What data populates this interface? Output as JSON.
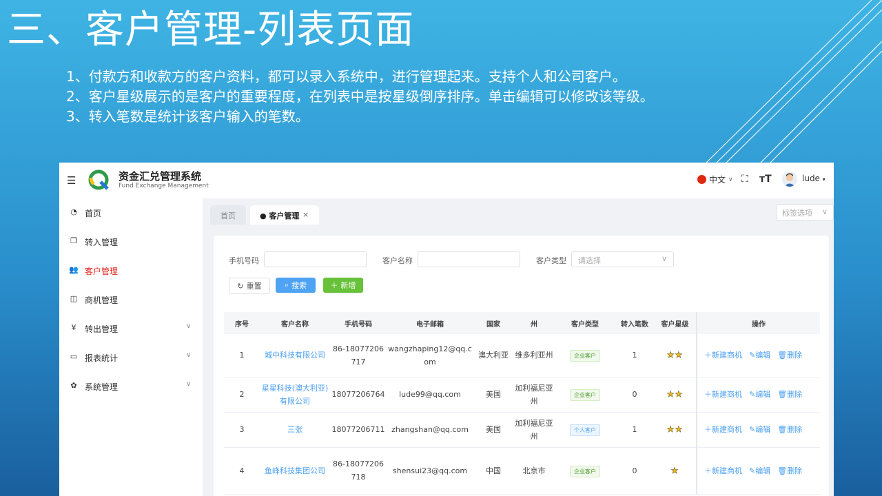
{
  "slide": {
    "title": "三、客户管理-列表页面",
    "notes": [
      "1、付款方和收款方的客户资料，都可以录入系统中，进行管理起来。支持个人和公司客户。",
      "2、客户星级展示的是客户的重要程度，在列表中是按星级倒序排序。单击编辑可以修改该等级。",
      "3、转入笔数是统计该客户输入的笔数。"
    ]
  },
  "header": {
    "system_name": "资金汇兑管理系统",
    "system_subtitle": "Fund Exchange Management",
    "language": "中文",
    "username": "lude"
  },
  "sidebar": {
    "items": [
      {
        "label": "首页",
        "icon": "dashboard-icon"
      },
      {
        "label": "转入管理",
        "icon": "copy-icon"
      },
      {
        "label": "客户管理",
        "icon": "users-icon",
        "active": true
      },
      {
        "label": "商机管理",
        "icon": "columns-icon"
      },
      {
        "label": "转出管理",
        "icon": "yen-icon",
        "expandable": true
      },
      {
        "label": "报表统计",
        "icon": "monitor-icon",
        "expandable": true
      },
      {
        "label": "系统管理",
        "icon": "gear-icon",
        "expandable": true
      }
    ]
  },
  "tabs": [
    {
      "label": "首页"
    },
    {
      "label": "客户管理",
      "active": true
    }
  ],
  "tag_options": "标签选项",
  "filters": {
    "phone_label": "手机号码",
    "name_label": "客户名称",
    "type_label": "客户类型",
    "type_placeholder": "请选择"
  },
  "buttons": {
    "reset": "重置",
    "search": "搜索",
    "add": "新增"
  },
  "table": {
    "columns": [
      "序号",
      "客户名称",
      "手机号码",
      "电子邮箱",
      "国家",
      "州",
      "客户类型",
      "转入笔数",
      "客户星级",
      "操作"
    ],
    "rows": [
      {
        "index": "1",
        "name": "城中科技有限公司",
        "phone": "86-18077206717",
        "email": "wangzhaping12@qq.com",
        "country": "澳大利亚",
        "state": "维多利亚州",
        "type": "企业客户",
        "type_kind": "corp",
        "count": "1",
        "stars": "★★"
      },
      {
        "index": "2",
        "name": "星星科技(澳大利亚)有限公司",
        "phone": "18077206764",
        "email": "lude99@qq.com",
        "country": "美国",
        "state": "加利福尼亚州",
        "type": "企业客户",
        "type_kind": "corp",
        "count": "0",
        "stars": "★★"
      },
      {
        "index": "3",
        "name": "三张",
        "phone": "18077206711",
        "email": "zhangshan@qq.com",
        "country": "美国",
        "state": "加利福尼亚州",
        "type": "个人客户",
        "type_kind": "pers",
        "count": "1",
        "stars": "★★"
      },
      {
        "index": "4",
        "name": "鱼峰科技集团公司",
        "phone": "86-18077206718",
        "email": "shensui23@qq.com",
        "country": "中国",
        "state": "北京市",
        "type": "企业客户",
        "type_kind": "corp",
        "count": "0",
        "stars": "★"
      }
    ],
    "actions": {
      "new_opportunity": "新建商机",
      "edit": "编辑",
      "delete": "删除"
    }
  },
  "colors": {
    "accent": "#4a9ff0",
    "active_menu": "#e6271f",
    "add_button": "#67c23a",
    "star": "#f7ba2a"
  }
}
